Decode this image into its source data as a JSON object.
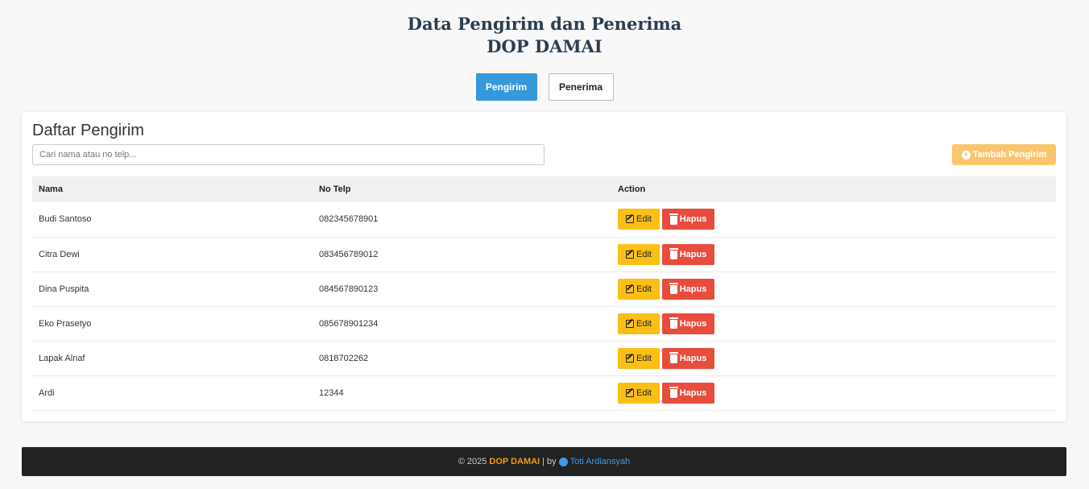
{
  "header": {
    "title_line1": "Data Pengirim dan Penerima",
    "title_line2": "DOP DAMAI"
  },
  "tabs": [
    {
      "label": "Pengirim",
      "active": true
    },
    {
      "label": "Penerima",
      "active": false
    }
  ],
  "card": {
    "title": "Daftar Pengirim",
    "search_placeholder": "Cari nama atau no telp...",
    "add_button": "Tambah Pengirim"
  },
  "table": {
    "headers": [
      "Nama",
      "No Telp",
      "Action"
    ],
    "rows": [
      {
        "name": "Budi Santoso",
        "phone": "082345678901"
      },
      {
        "name": "Citra Dewi",
        "phone": "083456789012"
      },
      {
        "name": "Dina Puspita",
        "phone": "084567890123"
      },
      {
        "name": "Eko Prasetyo",
        "phone": "085678901234"
      },
      {
        "name": "Lapak Alnaf",
        "phone": "0818702262"
      },
      {
        "name": "Ardi",
        "phone": "12344"
      }
    ],
    "edit_label": "Edit",
    "delete_label": "Hapus"
  },
  "footer": {
    "prefix": "© 2025",
    "brand": "DOP DAMAI",
    "separator": "| by",
    "author": "Toti Ardiansyah"
  },
  "colors": {
    "primary": "#3498db",
    "warning": "#fbbf16",
    "danger": "#e74c3c",
    "footer_bg": "#222222",
    "brand": "#f39c12"
  }
}
